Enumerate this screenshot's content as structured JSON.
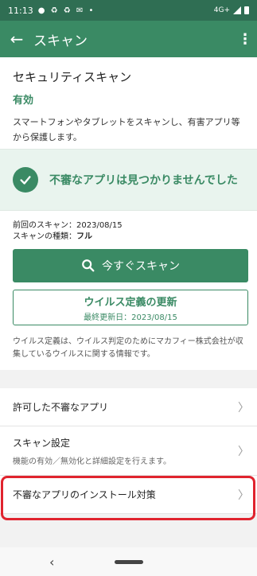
{
  "status_bar": {
    "time": "11:13",
    "icons": "● ♻ ♻ ✉ •",
    "network": "4G+"
  },
  "app_bar": {
    "title": "スキャン",
    "back_icon": "arrow-left-icon",
    "more_icon": "more-vert-icon"
  },
  "security_scan": {
    "heading": "セキュリティスキャン",
    "status": "有効",
    "description": "スマートフォンやタブレットをスキャンし、有害アプリ等から保護します。"
  },
  "result": {
    "message": "不審なアプリは見つかりませんでした",
    "icon": "check-circle-icon"
  },
  "scan_info": {
    "last_scan_label": "前回のスキャン：",
    "last_scan_value": "2023/08/15",
    "scan_type_label": "スキャンの種類：",
    "scan_type_value": "フル"
  },
  "buttons": {
    "scan_now": "今すぐスキャン",
    "update_title": "ウイルス定義の更新",
    "update_subtitle": "最終更新日：2023/08/15"
  },
  "note": "ウイルス定義は、ウイルス判定のためにマカフィー株式会社が収集しているウイルスに関する情報です。",
  "settings": {
    "allowed_apps": "許可した不審なアプリ",
    "scan_settings": "スキャン設定",
    "scan_settings_sub": "機能の有効／無効化と詳細設定を行えます。",
    "install_protection": "不審なアプリのインストール対策"
  },
  "colors": {
    "primary": "#3a8a64",
    "status_bar": "#2f6e53",
    "highlight": "#e0232e"
  }
}
